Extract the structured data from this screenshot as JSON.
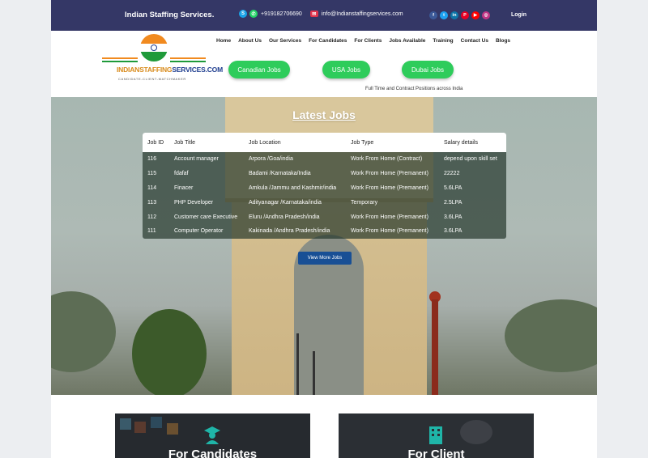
{
  "topbar": {
    "brand": "Indian Staffing Services.",
    "phone": "+919182706690",
    "email": "info@Indianstaffingservices.com",
    "login": "Login",
    "social_icons": [
      "facebook-icon",
      "twitter-icon",
      "linkedin-icon",
      "pinterest-icon",
      "youtube-icon",
      "instagram-icon"
    ]
  },
  "logo": {
    "name_part1": "INDIANSTAFFING",
    "name_part2": "SERVICES.COM",
    "tagline": "CANDIDATE-CLIENT-MATCHMAKER"
  },
  "nav": {
    "items": [
      "Home",
      "About Us",
      "Our Services",
      "For Candidates",
      "For Clients",
      "Jobs Available",
      "Training",
      "Contact Us",
      "Blogs"
    ]
  },
  "quick_links": {
    "canadian": "Canadian Jobs",
    "usa": "USA Jobs",
    "dubai": "Dubai Jobs"
  },
  "tagline": "Full Time and Contract Positions across India",
  "jobs": {
    "heading": "Latest Jobs",
    "columns": [
      "Job ID",
      "Job Title",
      "Job Location",
      "Job Type",
      "Salary details"
    ],
    "rows": [
      [
        "116",
        "Account manager",
        "Arpora /Goa/india",
        "Work From Home (Contract)",
        "depend upon skill set"
      ],
      [
        "115",
        "fdafaf",
        "Badami /Karnataka/India",
        "Work From Home (Premanent)",
        "22222"
      ],
      [
        "114",
        "Finacer",
        "Amkula /Jammu and Kashmir/india",
        "Work From Home (Premanent)",
        "5.6LPA"
      ],
      [
        "113",
        "PHP Developer",
        "Adityanagar /Karnataka/india",
        "Temporary",
        "2.5LPA"
      ],
      [
        "112",
        "Customer care Executive",
        "Eluru /Andhra Pradesh/india",
        "Work From Home (Premanent)",
        "3.6LPA"
      ],
      [
        "111",
        "Computer Operator",
        "Kakinada /Andhra Pradesh/india",
        "Work From Home (Premanent)",
        "3.6LPA"
      ]
    ],
    "view_more": "View More Jobs"
  },
  "cards": {
    "candidates": "For Candidates",
    "client": "For Client"
  },
  "colors": {
    "topbar": "#343766",
    "green_pill": "#2ecc5b",
    "view_more": "#184f95"
  }
}
